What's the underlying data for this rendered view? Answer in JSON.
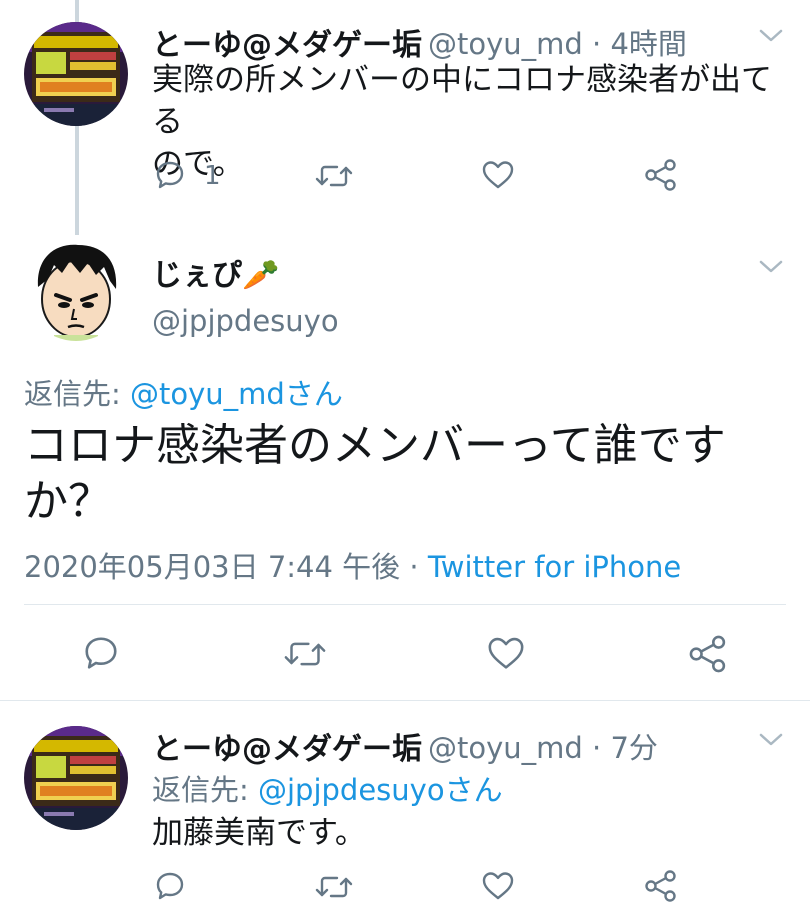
{
  "tweet1": {
    "name": "とーゆ@メダゲー垢",
    "handle": "@toyu_md",
    "sep": "·",
    "time": "4時間",
    "text_line1": "実際の所メンバーの中にコロナ感染者が出てる",
    "text_line2": "ので。",
    "reply_count": "1"
  },
  "main": {
    "name": "じぇぴ",
    "emoji": "🥕",
    "handle": "@jpjpdesuyo",
    "reply_to_label": "返信先: ",
    "reply_to_user": "@toyu_mdさん",
    "text_line1": "コロナ感染者のメンバーって誰です",
    "text_line2": "か？",
    "datetime": "2020年05月03日 7:44 午後",
    "sep": " · ",
    "source": "Twitter for iPhone"
  },
  "tweet3": {
    "name": "とーゆ@メダゲー垢",
    "handle": "@toyu_md",
    "sep": "·",
    "time": "7分",
    "reply_to_label": "返信先: ",
    "reply_to_user": "@jpjpdesuyoさん",
    "text": "加藤美南です。"
  },
  "colors": {
    "text": "#14171a",
    "secondary": "#657786",
    "link": "#1b95e0",
    "divider": "#e1e8ed",
    "thread_line": "#ccd6dd"
  }
}
